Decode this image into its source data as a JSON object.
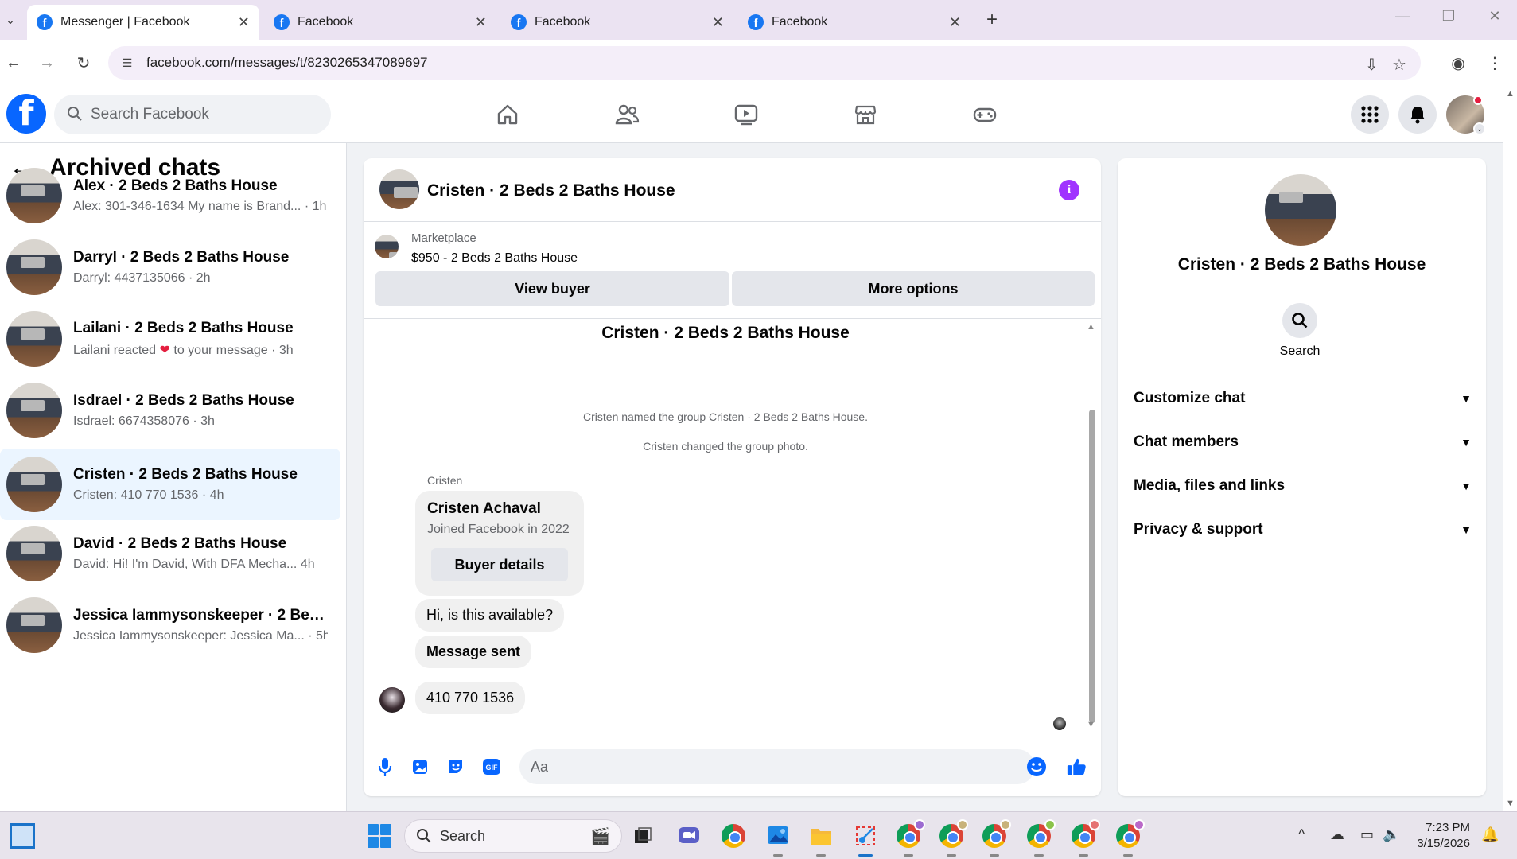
{
  "browser": {
    "tabs": [
      {
        "label": "Messenger | Facebook",
        "active": true
      },
      {
        "label": "Facebook",
        "active": false
      },
      {
        "label": "Facebook",
        "active": false
      },
      {
        "label": "Facebook",
        "active": false
      }
    ],
    "url": "facebook.com/messages/t/8230265347089697"
  },
  "fb_header": {
    "logo_letter": "f",
    "search_placeholder": "Search Facebook"
  },
  "left_panel": {
    "title": "Archived chats",
    "chats": [
      {
        "name": "Alex · 2 Beds 2 Baths House",
        "preview": "Alex: 301-346-1634 My name is Brand... · 1h",
        "selected": false
      },
      {
        "name": "Darryl · 2 Beds 2 Baths House",
        "preview": "Darryl: 4437135066 · 2h",
        "selected": false
      },
      {
        "name": "Lailani · 2 Beds 2 Baths House",
        "preview_before": "Lailani reacted",
        "preview_after": "to your message · 3h",
        "selected": false
      },
      {
        "name": "Isdrael · 2 Beds 2 Baths House",
        "preview": "Isdrael: 6674358076 · 3h",
        "selected": false
      },
      {
        "name": "Cristen · 2 Beds 2 Baths House",
        "preview": "Cristen: 410 770 1536 · 4h",
        "selected": true
      },
      {
        "name": "David · 2 Beds 2 Baths House",
        "preview": "David: Hi! I'm David, With DFA Mecha...  4h",
        "selected": false
      },
      {
        "name": "Jessica Iammysonskeeper · 2 Beds ...",
        "preview": "Jessica Iammysonskeeper: Jessica Ma... · 5h",
        "selected": false
      }
    ]
  },
  "conversation": {
    "header_title": "Cristen · 2 Beds 2 Baths House",
    "marketplace_label": "Marketplace",
    "listing": "$950 - 2 Beds 2 Baths House",
    "view_buyer_label": "View buyer",
    "more_options_label": "More options",
    "thread_title": "Cristen · 2 Beds 2 Baths House",
    "system_messages": [
      "Cristen named the group Cristen · 2 Beds 2 Baths House.",
      "Cristen changed the group photo."
    ],
    "sender_name": "Cristen",
    "buyer_card": {
      "name": "Cristen Achaval",
      "joined": "Joined Facebook in 2022",
      "button_label": "Buyer details"
    },
    "messages": [
      {
        "text": "Hi, is this available?",
        "bold": false
      },
      {
        "text": "Message sent",
        "bold": true
      },
      {
        "text": "410 770 1536",
        "bold": false
      }
    ],
    "composer_placeholder": "Aa"
  },
  "right_panel": {
    "title": "Cristen · 2 Beds 2 Baths House",
    "search_label": "Search",
    "sections": [
      "Customize chat",
      "Chat members",
      "Media, files and links",
      "Privacy & support"
    ]
  },
  "taskbar": {
    "search_label": "Search",
    "time": "7:23 PM",
    "date": "3/15/2026"
  },
  "colors": {
    "fb_blue": "#0866ff",
    "selected_chat": "#ebf5ff",
    "info_purple": "#a033ff",
    "heart_red": "#e41e3f"
  }
}
